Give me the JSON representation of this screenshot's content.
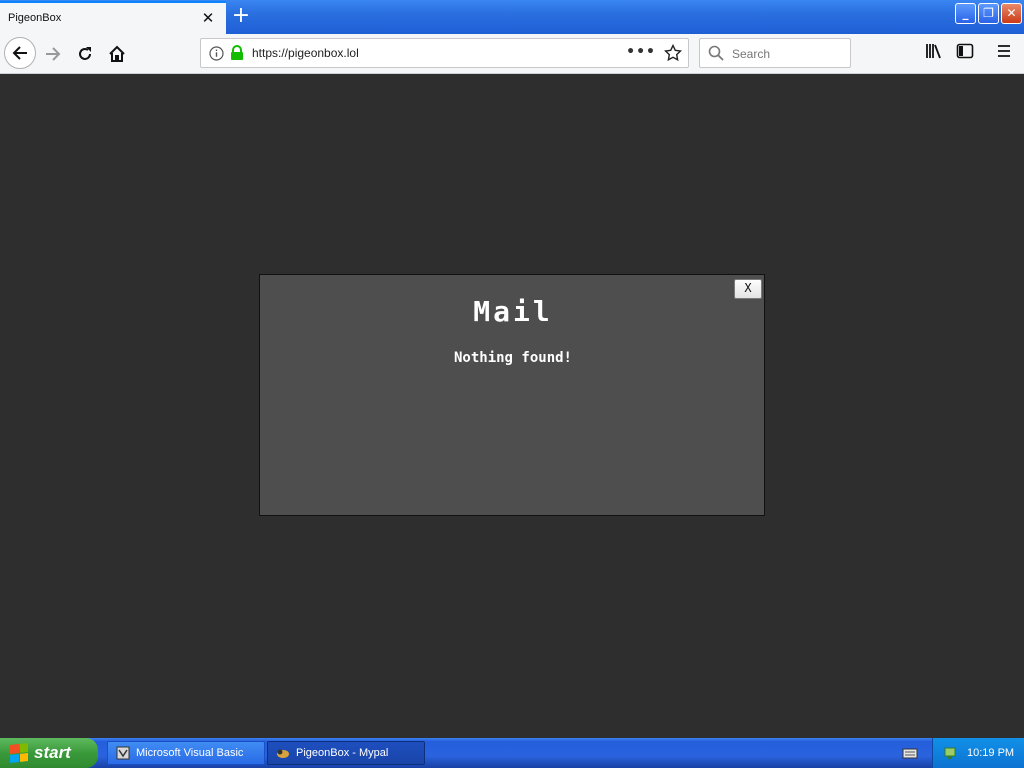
{
  "browser": {
    "tab": {
      "title": "PigeonBox"
    },
    "url": "https://pigeonbox.lol",
    "search_placeholder": "Search"
  },
  "modal": {
    "title": "Mail",
    "message": "Nothing found!",
    "close_label": "X"
  },
  "taskbar": {
    "start_label": "start",
    "tasks": [
      {
        "label": "Microsoft Visual Basic",
        "icon": "vb-icon"
      },
      {
        "label": "PigeonBox - Mypal",
        "icon": "mypal-icon"
      }
    ],
    "clock": "10:19 PM"
  },
  "colors": {
    "page_bg": "#2e2e2e",
    "modal_bg": "#4e4e4e",
    "titlebar_blue": "#2a6fe0"
  }
}
